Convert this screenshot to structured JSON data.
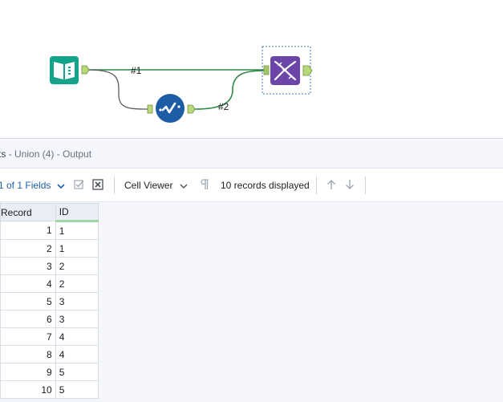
{
  "workflow": {
    "connections": [
      {
        "label": "#1"
      },
      {
        "label": "#2"
      }
    ],
    "tools": [
      {
        "name": "input-tool",
        "icon": "book-icon",
        "color": "#12a38a"
      },
      {
        "name": "unique-tool",
        "icon": "checkmark-wave-icon",
        "color": "#1d5da6"
      },
      {
        "name": "union-tool",
        "icon": "dna-icon",
        "color": "#6b46a8"
      }
    ],
    "anchor_color": "#b8d97a",
    "wire_color": "#2f8a4a"
  },
  "results": {
    "title_prefix": "ts",
    "title_main": " - Union (4) - Output",
    "fields_label": "1 of 1 Fields",
    "cell_viewer_label": "Cell Viewer",
    "records_label": "10 records displayed",
    "columns": [
      "Record",
      "ID"
    ],
    "rows": [
      [
        "1",
        "1"
      ],
      [
        "2",
        "1"
      ],
      [
        "3",
        "2"
      ],
      [
        "4",
        "2"
      ],
      [
        "5",
        "3"
      ],
      [
        "6",
        "3"
      ],
      [
        "7",
        "4"
      ],
      [
        "8",
        "4"
      ],
      [
        "9",
        "5"
      ],
      [
        "10",
        "5"
      ]
    ]
  }
}
